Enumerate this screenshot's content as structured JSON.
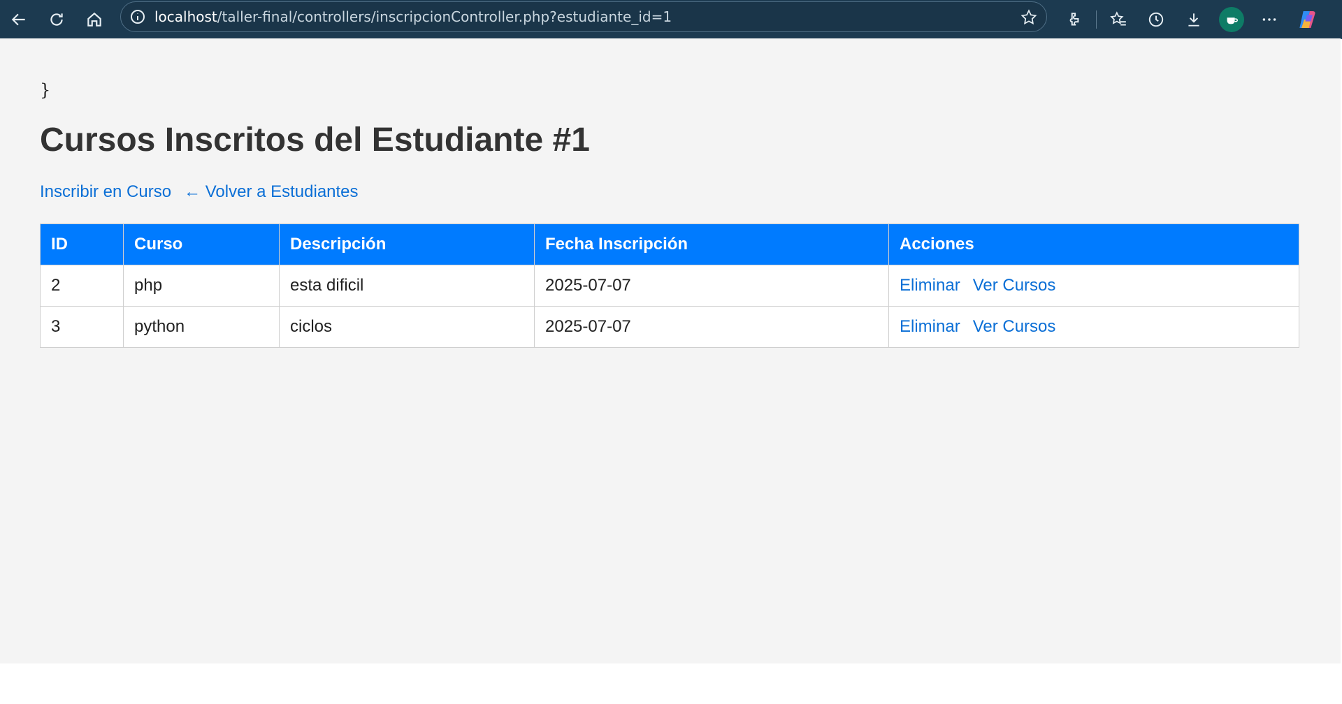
{
  "browser": {
    "url_host": "localhost",
    "url_path": "/taller-final/controllers/inscripcionController.php?estudiante_id=1"
  },
  "page": {
    "stray_text": "}",
    "title": "Cursos Inscritos del Estudiante #1",
    "links": {
      "enroll": "Inscribir en Curso",
      "back": "← Volver a Estudiantes"
    },
    "table": {
      "headers": [
        "ID",
        "Curso",
        "Descripción",
        "Fecha Inscripción",
        "Acciones"
      ],
      "rows": [
        {
          "id": "2",
          "curso": "php",
          "descripcion": "esta dificil",
          "fecha": "2025-07-07",
          "action_delete": "Eliminar",
          "action_view": "Ver Cursos"
        },
        {
          "id": "3",
          "curso": "python",
          "descripcion": "ciclos",
          "fecha": "2025-07-07",
          "action_delete": "Eliminar",
          "action_view": "Ver Cursos"
        }
      ]
    }
  },
  "colors": {
    "header_bg": "#007bff",
    "link": "#0b6fd6",
    "browser_bar": "#1c3a50"
  }
}
